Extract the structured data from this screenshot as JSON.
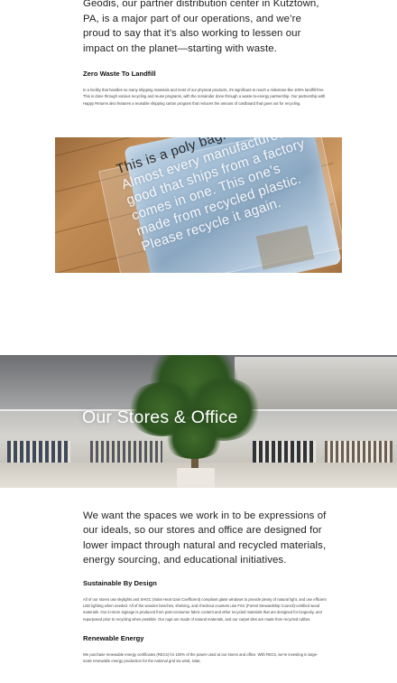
{
  "intro": {
    "lead": "Geodis, our partner distribution center in Kutztown, PA, is a major part of our operations, and we’re proud to say that it’s also working to lessen our impact on the planet—starting with waste.",
    "zero_waste_heading": "Zero Waste To Landfill",
    "zero_waste_text": "In a facility that handles so many shipping materials and most of our physical products, it’s significant to reach a milestone like 100% landfill-free. This is done through various recycling and reuse programs, with the remainder done through a waste-to-energy partnership. Our partnership with Happy Returns also features a reusable shipping carton program that reduces the amount of cardboard that goes out for recycling."
  },
  "poly_photo": {
    "bag_line_1": "This is a poly bag.",
    "bag_lines": [
      "Almost every manufactured",
      "good that ships from a factory",
      "comes in one. This one’s",
      "made from recycled plastic.",
      "Please recycle it again."
    ]
  },
  "stores": {
    "title": "Our Stores & Office",
    "lead": "We want the spaces we work in to be expressions of our ideals, so our stores and office are designed for lower impact through natural and recycled materials, energy sourcing, and educational initiatives.",
    "sustainable_heading": "Sustainable By Design",
    "sustainable_text": "All of our stores use skylights and SHGC (Solar Heat Gain Coefficient) compliant glass windows to provide plenty of natural light, and use efficient LED lighting when needed. All of the wooden benches, shelving, and checkout counters use FSC (Forest Stewardship Council)-certified wood materials. Our in-store signage is produced from post-consumer fabric content and other recycled materials that are designed for longevity, and repurposed prior to recycling when possible. Our rugs are made of natural materials, and our carpet tiles are made from recycled rubber.",
    "renewable_heading": "Renewable Energy",
    "renewable_text": "We purchase renewable energy certificates (RECs) for 100% of the power used at our stores and office. With RECs, we’re investing in large-scale renewable energy production for the national grid via wind, solar,"
  }
}
